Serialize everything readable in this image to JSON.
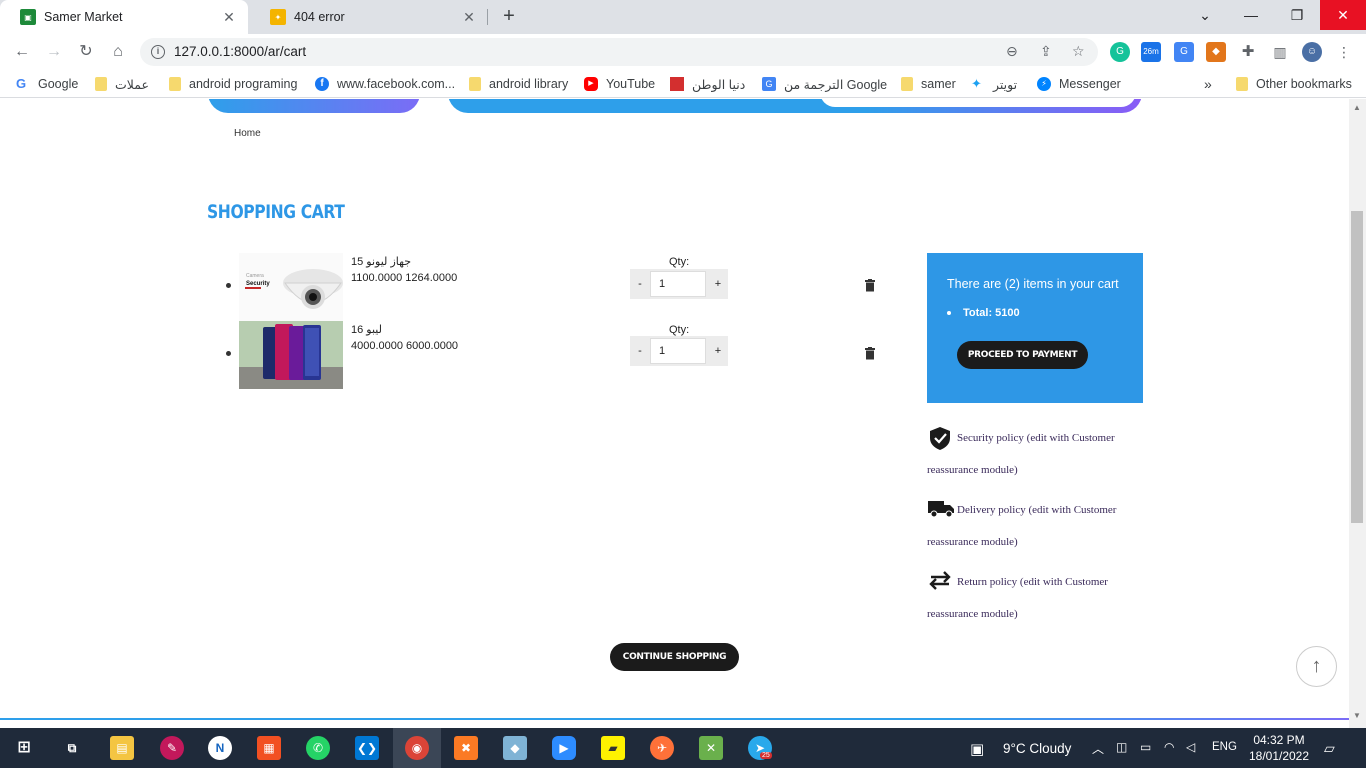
{
  "browser": {
    "tabs": [
      {
        "title": "Samer Market",
        "active": true
      },
      {
        "title": "404 error",
        "active": false
      }
    ],
    "new_tab": "+",
    "url": "127.0.0.1:8000/ar/cart",
    "extension_badge": "26m",
    "bookmarks": [
      {
        "label": "Google",
        "icon": "google-icon"
      },
      {
        "label": "عملات",
        "icon": "folder-icon"
      },
      {
        "label": "android programing",
        "icon": "folder-icon"
      },
      {
        "label": "www.facebook.com...",
        "icon": "facebook-icon"
      },
      {
        "label": "android library",
        "icon": "folder-icon"
      },
      {
        "label": "YouTube",
        "icon": "youtube-icon"
      },
      {
        "label": "دنيا الوطن",
        "icon": "site-icon"
      },
      {
        "label": "الترجمة من Google",
        "icon": "translate-icon"
      },
      {
        "label": "samer",
        "icon": "folder-icon"
      },
      {
        "label": "تويتر",
        "icon": "twitter-icon"
      },
      {
        "label": "Messenger",
        "icon": "messenger-icon"
      }
    ],
    "overflow": "»",
    "other_bookmarks": "Other bookmarks"
  },
  "page": {
    "breadcrumb": "Home",
    "cart_title": "SHOPPING CART",
    "items": [
      {
        "name": "جهاز ليونو 15",
        "prices": "1100.0000 1264.0000",
        "qty_label": "Qty:",
        "qty": "1",
        "minus": "-",
        "plus": "+",
        "thumb_text_1": "Camera",
        "thumb_text_2": "Security"
      },
      {
        "name": "ليبو 16",
        "prices": "4000.0000 6000.0000",
        "qty_label": "Qty:",
        "qty": "1",
        "minus": "-",
        "plus": "+"
      }
    ],
    "summary": {
      "title": "There are (2) items in your cart",
      "total": "Total: 5100",
      "pay_button": "PROCEED TO PAYMENT"
    },
    "policies": [
      {
        "icon": "shield-check-icon",
        "text": "Security policy (edit with Customer reassurance module)"
      },
      {
        "icon": "truck-icon",
        "text": "Delivery policy (edit with Customer reassurance module)"
      },
      {
        "icon": "swap-arrows-icon",
        "text": "Return policy (edit with Customer reassurance module)"
      }
    ],
    "continue_button": "CONTINUE SHOPPING",
    "accent": "#2e97e6"
  },
  "taskbar": {
    "weather": "9°C  Cloudy",
    "language": "ENG",
    "time": "04:32 PM",
    "date": "18/01/2022",
    "telegram_badge": "25"
  }
}
